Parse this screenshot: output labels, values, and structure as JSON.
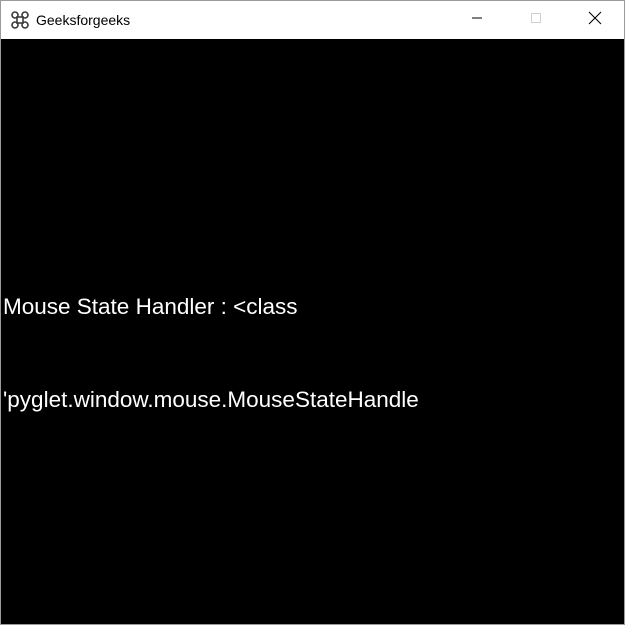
{
  "window": {
    "title": "Geeksforgeeks",
    "app_icon": "pyglet-cmd-icon",
    "controls": {
      "minimize_icon": "minimize-icon",
      "maximize_icon": "maximize-icon",
      "close_icon": "close-icon"
    }
  },
  "client": {
    "background": "#000000",
    "text_color": "#ffffff",
    "line1": "Mouse State Handler : <class",
    "line2": "'pyglet.window.mouse.MouseStateHandle"
  }
}
